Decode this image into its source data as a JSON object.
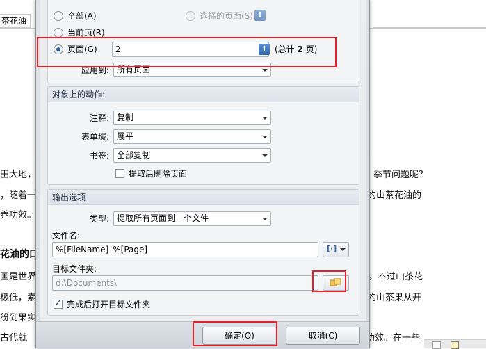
{
  "background_doc": {
    "tab_label": "茶花油",
    "lines": [
      {
        "left": "田大地，",
        "right": "季节问题呢？"
      },
      {
        "left": "，随着一",
        "right": "的山茶花油的"
      },
      {
        "left": "养功效。",
        "right": ""
      },
      {
        "left": "国是世界",
        "right": "。不过山茶花"
      },
      {
        "left": "极低，素",
        "right": "的山茶果从开"
      },
      {
        "left": "纷到果实",
        "right": ""
      },
      {
        "left": "古代就",
        "right": "功效。在一些"
      }
    ],
    "heading": "花油的口"
  },
  "page_range": {
    "all_label": "全部(A)",
    "current_label": "当前页(R)",
    "pages_label": "页面(G)",
    "selected_label": "选择的页面(S)",
    "pages_value": "2",
    "total_prefix": "(总计",
    "total_count": "2",
    "total_suffix": "页)",
    "apply_to_label": "应用到:",
    "apply_to_value": "所有页面"
  },
  "object_actions": {
    "title": "对象上的动作:",
    "annotations_label": "注释:",
    "annotations_value": "复制",
    "form_fields_label": "表单域:",
    "form_fields_value": "展平",
    "bookmarks_label": "书签:",
    "bookmarks_value": "全部复制",
    "delete_after_label": "提取后删除页面"
  },
  "output_options": {
    "title": "输出选项",
    "type_label": "类型:",
    "type_value": "提取所有页面到一个文件",
    "filename_label": "文件名:",
    "filename_value": "%[FileName]_%[Page]",
    "macro_button_glyph": "[·]",
    "target_folder_label": "目标文件夹:",
    "target_folder_value": "d:\\Documents\\",
    "open_folder_label": "完成后打开目标文件夹"
  },
  "buttons": {
    "ok": "确定(O)",
    "cancel": "取消(C)"
  },
  "colors": {
    "highlight": "#e0222b",
    "radio_checked": "#2c5d9a",
    "info_icon": "#2d66b0"
  }
}
